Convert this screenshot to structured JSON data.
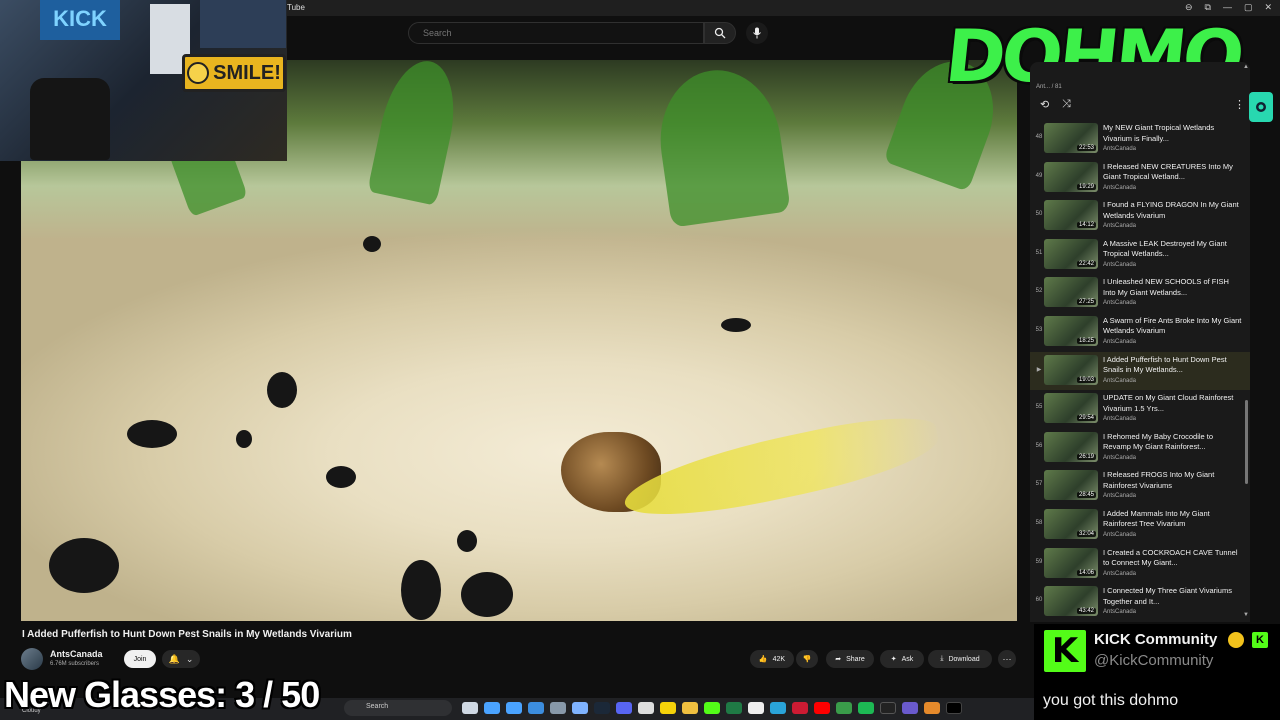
{
  "browser": {
    "tab_title": "Tube",
    "win_buttons": [
      "⊖",
      "⧉",
      "—",
      "▢",
      "✕"
    ]
  },
  "header": {
    "search_placeholder": "Search"
  },
  "overlay": {
    "logo_text": "DOHMO",
    "counter_label": "New Glasses:",
    "counter_value": "3 / 50",
    "webcam_sign": "SMILE!",
    "webcam_banner": "KICK"
  },
  "video": {
    "title": "I Added Pufferfish to Hunt Down Pest Snails in My Wetlands Vivarium",
    "channel": "AntsCanada",
    "subscribers": "6.76M subscribers",
    "join_label": "Join",
    "like_count": "42K",
    "share_label": "Share",
    "ask_label": "Ask",
    "download_label": "Download"
  },
  "playlist": {
    "position": "Ant... / 81",
    "items": [
      {
        "num": "48",
        "title": "My NEW Giant Tropical Wetlands Vivarium is Finally...",
        "channel": "AntsCanada",
        "duration": "22:53",
        "active": false
      },
      {
        "num": "49",
        "title": "I Released NEW CREATURES Into My Giant Tropical Wetland...",
        "channel": "AntsCanada",
        "duration": "19:29",
        "active": false
      },
      {
        "num": "50",
        "title": "I Found a FLYING DRAGON In My Giant Wetlands Vivarium",
        "channel": "AntsCanada",
        "duration": "14:12",
        "active": false
      },
      {
        "num": "51",
        "title": "A Massive LEAK Destroyed My Giant Tropical Wetlands...",
        "channel": "AntsCanada",
        "duration": "22:42",
        "active": false
      },
      {
        "num": "52",
        "title": "I Unleashed NEW SCHOOLS of FISH Into My Giant Wetlands...",
        "channel": "AntsCanada",
        "duration": "27:25",
        "active": false
      },
      {
        "num": "53",
        "title": "A Swarm of Fire Ants Broke Into My Giant Wetlands Vivarium",
        "channel": "AntsCanada",
        "duration": "18:25",
        "active": false
      },
      {
        "num": "▶",
        "title": "I Added Pufferfish to Hunt Down Pest Snails in My Wetlands...",
        "channel": "AntsCanada",
        "duration": "19:03",
        "active": true
      },
      {
        "num": "55",
        "title": "UPDATE on My Giant Cloud Rainforest Vivarium 1.5 Yrs...",
        "channel": "AntsCanada",
        "duration": "29:54",
        "active": false
      },
      {
        "num": "56",
        "title": "I Rehomed My Baby Crocodile to Revamp My Giant Rainforest...",
        "channel": "AntsCanada",
        "duration": "26:19",
        "active": false
      },
      {
        "num": "57",
        "title": "I Released FROGS Into My Giant Rainforest Vivariums",
        "channel": "AntsCanada",
        "duration": "28:45",
        "active": false
      },
      {
        "num": "58",
        "title": "I Added Mammals Into My Giant Rainforest Tree Vivarium",
        "channel": "AntsCanada",
        "duration": "32:04",
        "active": false
      },
      {
        "num": "59",
        "title": "I Created a COCKROACH CAVE Tunnel to Connect My Giant...",
        "channel": "AntsCanada",
        "duration": "14:06",
        "active": false
      },
      {
        "num": "60",
        "title": "I Connected My Three Giant Vivariums Together and It...",
        "channel": "AntsCanada",
        "duration": "43:42",
        "active": false
      }
    ]
  },
  "taskbar": {
    "search_label": "Search",
    "weather": "Cloudy"
  },
  "chat": {
    "name": "KICK Community",
    "handle": "@KickCommunity",
    "message": "you got this dohmo",
    "badge_k": "K"
  },
  "colors": {
    "kick_green": "#53fc18",
    "logo_green": "#3df04a",
    "yt_bg": "#0f0f0f"
  }
}
